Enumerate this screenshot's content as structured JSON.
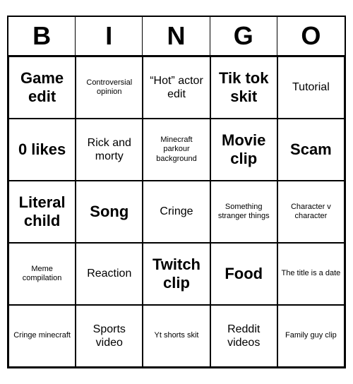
{
  "header": {
    "letters": [
      "B",
      "I",
      "N",
      "G",
      "O"
    ]
  },
  "cells": [
    {
      "text": "Game edit",
      "size": "large"
    },
    {
      "text": "Controversial opinion",
      "size": "small"
    },
    {
      "text": "“Hot” actor edit",
      "size": "medium"
    },
    {
      "text": "Tik tok skit",
      "size": "large"
    },
    {
      "text": "Tutorial",
      "size": "medium"
    },
    {
      "text": "0 likes",
      "size": "large"
    },
    {
      "text": "Rick and morty",
      "size": "medium"
    },
    {
      "text": "Minecraft parkour background",
      "size": "small"
    },
    {
      "text": "Movie clip",
      "size": "large"
    },
    {
      "text": "Scam",
      "size": "large"
    },
    {
      "text": "Literal child",
      "size": "large"
    },
    {
      "text": "Song",
      "size": "large"
    },
    {
      "text": "Cringe",
      "size": "medium"
    },
    {
      "text": "Something stranger things",
      "size": "small"
    },
    {
      "text": "Character v character",
      "size": "small"
    },
    {
      "text": "Meme compilation",
      "size": "small"
    },
    {
      "text": "Reaction",
      "size": "medium"
    },
    {
      "text": "Twitch clip",
      "size": "large"
    },
    {
      "text": "Food",
      "size": "large"
    },
    {
      "text": "The title is a date",
      "size": "small"
    },
    {
      "text": "Cringe minecraft",
      "size": "small"
    },
    {
      "text": "Sports video",
      "size": "medium"
    },
    {
      "text": "Yt shorts skit",
      "size": "small"
    },
    {
      "text": "Reddit videos",
      "size": "medium"
    },
    {
      "text": "Family guy clip",
      "size": "small"
    }
  ]
}
